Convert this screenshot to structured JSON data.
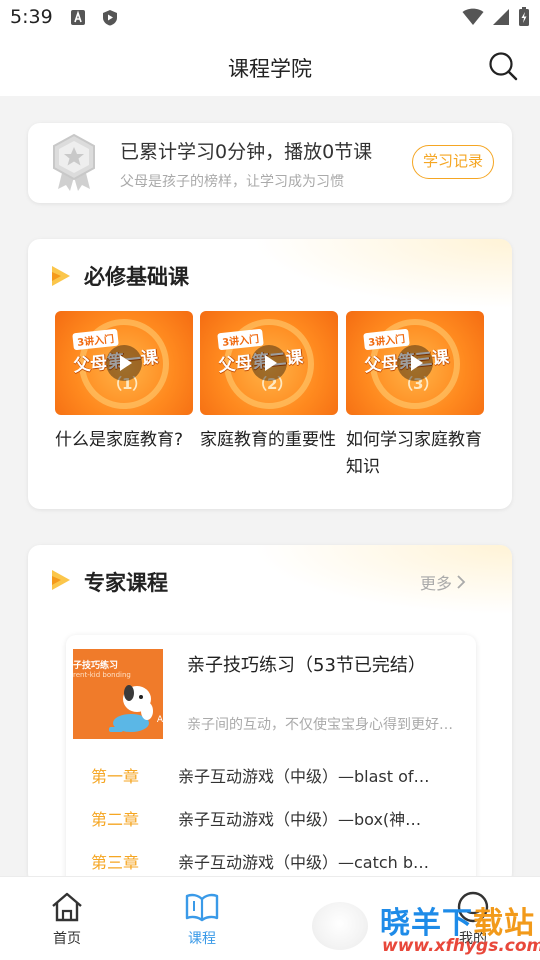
{
  "status_bar": {
    "time": "5:39"
  },
  "header": {
    "title": "课程学院"
  },
  "stats": {
    "headline": "已累计学习0分钟，播放0节课",
    "subtitle": "父母是孩子的榜样，让学习成为习惯",
    "record_button": "学习记录"
  },
  "basic_section": {
    "title": "必修基础课",
    "courses": [
      {
        "tag": "3讲入门",
        "cover_title": "父母第一课",
        "number": "（1）",
        "name": "什么是家庭教育?"
      },
      {
        "tag": "3讲入门",
        "cover_title": "父母第二课",
        "number": "（2）",
        "name": "家庭教育的重要性"
      },
      {
        "tag": "3讲入门",
        "cover_title": "父母第三课",
        "number": "（3）",
        "name": "如何学习家庭教育知识"
      }
    ]
  },
  "expert_section": {
    "title": "专家课程",
    "more_label": "更多",
    "course": {
      "cover_text": "子技巧练习",
      "cover_subtext": "rent-kid bonding",
      "cover_mark": "A",
      "title": "亲子技巧练习（53节已完结）",
      "description": "亲子间的互动，不仅使宝宝身心得到更好…",
      "chapters": [
        {
          "label": "第一章",
          "text": "亲子互动游戏（中级）—blast of…"
        },
        {
          "label": "第二章",
          "text": "亲子互动游戏（中级）—box(神…"
        },
        {
          "label": "第三章",
          "text": "亲子互动游戏（中级）—catch b…"
        }
      ]
    }
  },
  "tabbar": {
    "tabs": [
      {
        "label": "首页",
        "active": false
      },
      {
        "label": "课程",
        "active": true
      },
      {
        "label": "我的",
        "active": false
      }
    ]
  },
  "watermark": {
    "brand_part1": "晓羊下",
    "brand_part2": "载站",
    "site": "www.xfhygs.com"
  },
  "colors": {
    "accent": "#f5a623",
    "tab_active": "#3a9ae8",
    "watermark_blue": "#1e8be8",
    "watermark_red": "#e8483b"
  }
}
